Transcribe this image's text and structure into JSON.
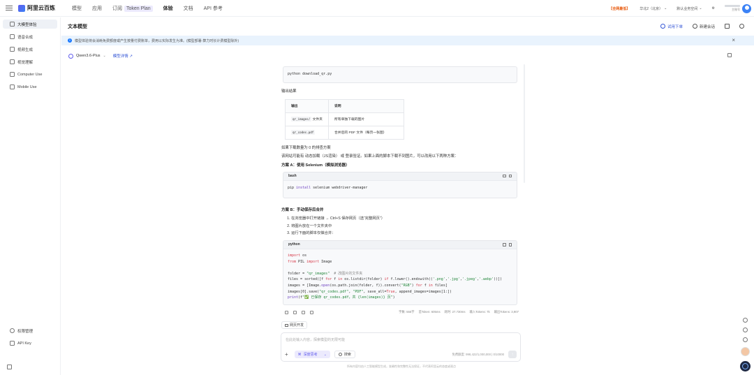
{
  "topbar": {
    "brand": "阿里云百炼",
    "nav": [
      "模型",
      "应用",
      "订阅",
      "体验",
      "文档",
      "API 参考"
    ],
    "subscribe_badge": "Token Plan",
    "promo": "【全网最低】",
    "region": "华北2（北京）",
    "workspace": "默认业务空间",
    "user_sub": "主账号"
  },
  "sidebar": {
    "items": [
      "大模型体验",
      "语音合成",
      "视频生成",
      "视觉理解",
      "Computer Use",
      "Mobile Use"
    ],
    "bottom": [
      "权限管理",
      "API Key"
    ]
  },
  "header": {
    "title": "文本模型",
    "try_order": "试用下单",
    "new_chat": "新建会话"
  },
  "notice": {
    "text": "模型体验将会消耗免费额度或产生按量付费账单，费用以实际发生为准。(模型部署-算力时长计费模型除外)"
  },
  "model": {
    "name": "Qwen3.6-Plus",
    "detail_link": "模型详情"
  },
  "chat": {
    "code1": {
      "body": "python download_qr.py"
    },
    "output_heading": "输出结果",
    "table": {
      "headers": [
        "输出",
        "说明"
      ],
      "rows": [
        {
          "code": "qr_images/",
          "suffix": "文件夹",
          "desc": "所有单独下载的图片"
        },
        {
          "code": "qr_codes.pdf",
          "suffix": "",
          "desc": "合并后的 PDF 文件（每页一张图）"
        }
      ]
    },
    "fail_heading": "如果下载数量为 0 的排查方案",
    "fail_text": "该网站可能有 动态加载（JS渲染） 或 登录验证。如果上面的脚本下载不到图片，可以改用以下两种方案：",
    "plan_a": "方案 A：使用 Selenium（模拟浏览器）",
    "code2": {
      "lang": "bash",
      "body": "pip install selenium webdriver-manager"
    },
    "plan_b": "方案 B：手动保存后合并",
    "steps": [
      "在浏览器中打开链接 → Ctrl+S 保存网页（选“完整网页”）",
      "将图片放在一个文件夹中",
      "运行下面的脚本仅做合并："
    ],
    "code3": {
      "lang": "python"
    }
  },
  "stats": {
    "prompt": "字数: 555字",
    "first_token": "首Token: 605ms",
    "total": "耗时: 27.730ms",
    "in_tokens": "输入Tokens: 7k",
    "out_tokens": "输出Tokens: 3,907"
  },
  "web_dev": "网页开发",
  "input": {
    "placeholder": "在此处输入内容，探索模型的无限可能",
    "deep_think": "深度思考",
    "search": "搜索",
    "quota": "免费额度: 998,422/1,000,000  |  0/10000"
  },
  "disclaimer": "所有内容均由人工智能模型生成，准确性和完整性无法保证，不代表阿里云的态度或观点"
}
